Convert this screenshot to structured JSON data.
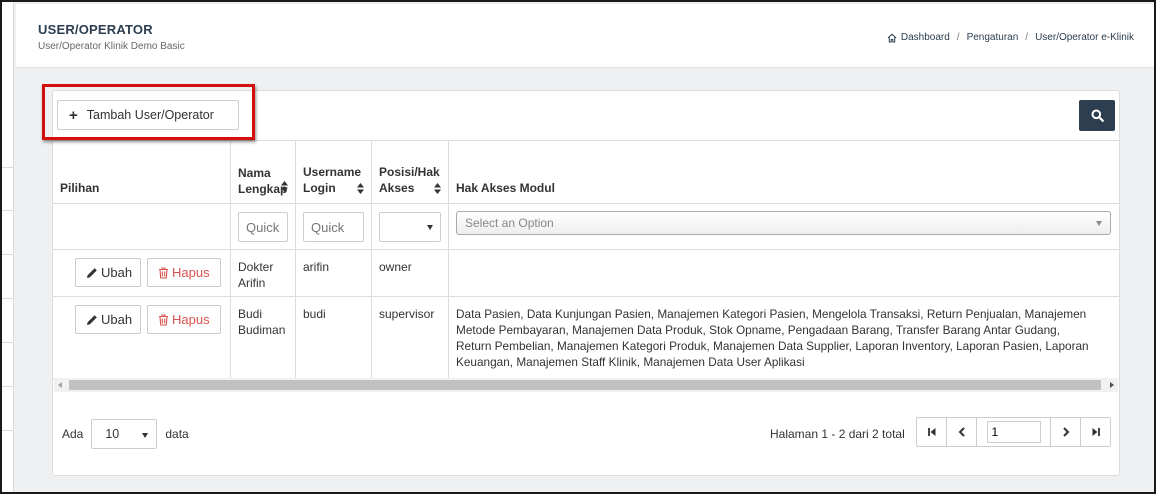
{
  "header": {
    "title": "USER/OPERATOR",
    "subtitle": "User/Operator Klinik Demo Basic",
    "breadcrumb": [
      "Dashboard",
      "Pengaturan",
      "User/Operator e-Klinik"
    ],
    "breadcrumb_separator": "/"
  },
  "toolbar": {
    "add_label": "Tambah User/Operator",
    "add_icon": "plus-icon",
    "search_icon": "search-icon"
  },
  "table": {
    "columns": {
      "pilihan": "Pilihan",
      "nama_1": "Nama",
      "nama_2": "Lengkap",
      "username_1": "Username",
      "username_2": "Login",
      "posisi_1": "Posisi/Hak",
      "posisi_2": "Akses",
      "modul": "Hak Akses Modul"
    },
    "filters": {
      "nama_placeholder": "Quick",
      "username_placeholder": "Quick",
      "posisi_value": "",
      "modul_placeholder": "Select an Option"
    },
    "action_labels": {
      "edit": "Ubah",
      "delete": "Hapus"
    },
    "rows": [
      {
        "nama_1": "Dokter",
        "nama_2": "Arifin",
        "username": "arifin",
        "posisi": "owner",
        "modul": ""
      },
      {
        "nama_1": "Budi",
        "nama_2": "Budiman",
        "username": "budi",
        "posisi": "supervisor",
        "modul_lines": [
          "Data Pasien, Data Kunjungan Pasien, Manajemen Kategori Pasien, Mengelola Transaksi, Return Penjualan, Manajemen",
          "Metode Pembayaran, Manajemen Data Produk, Stok Opname, Pengadaan Barang, Transfer Barang Antar Gudang,",
          "Return Pembelian, Manajemen Kategori Produk, Manajemen Data Supplier, Laporan Inventory, Laporan Pasien, Laporan",
          "Keuangan, Manajemen Staff Klinik, Manajemen Data User Aplikasi"
        ]
      }
    ]
  },
  "footer": {
    "show_prefix": "Ada",
    "page_size": "10",
    "show_suffix": "data",
    "page_info": "Halaman 1 - 2 dari 2 total",
    "current_page": "1"
  },
  "colors": {
    "accent_dark": "#2c3e50",
    "danger": "#d9534f",
    "highlight_border": "#d40d0d"
  }
}
